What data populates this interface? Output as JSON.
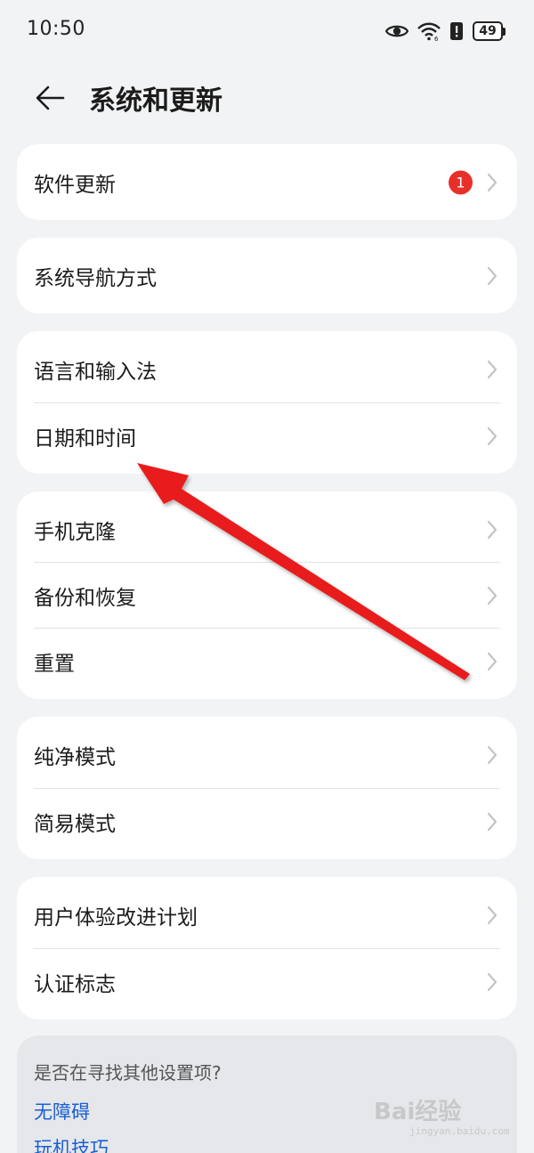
{
  "status": {
    "time": "10:50",
    "battery": "49"
  },
  "header": {
    "title": "系统和更新"
  },
  "cards": {
    "update": {
      "label": "软件更新",
      "badge": "1"
    },
    "navigation": {
      "label": "系统导航方式"
    },
    "language": {
      "label": "语言和输入法"
    },
    "datetime": {
      "label": "日期和时间"
    },
    "clone": {
      "label": "手机克隆"
    },
    "backup": {
      "label": "备份和恢复"
    },
    "reset": {
      "label": "重置"
    },
    "pure": {
      "label": "纯净模式"
    },
    "simple": {
      "label": "简易模式"
    },
    "ux": {
      "label": "用户体验改进计划"
    },
    "cert": {
      "label": "认证标志"
    }
  },
  "suggest": {
    "title": "是否在寻找其他设置项?",
    "links": [
      "无障碍",
      "玩机技巧"
    ]
  },
  "watermark": {
    "brand": "Bai经验",
    "url": "jingyan.baidu.com"
  },
  "colors": {
    "background": "#f1f3f5",
    "card": "#ffffff",
    "badge": "#e8302a",
    "link": "#1a5fd6",
    "arrow": "#e81c1c"
  }
}
